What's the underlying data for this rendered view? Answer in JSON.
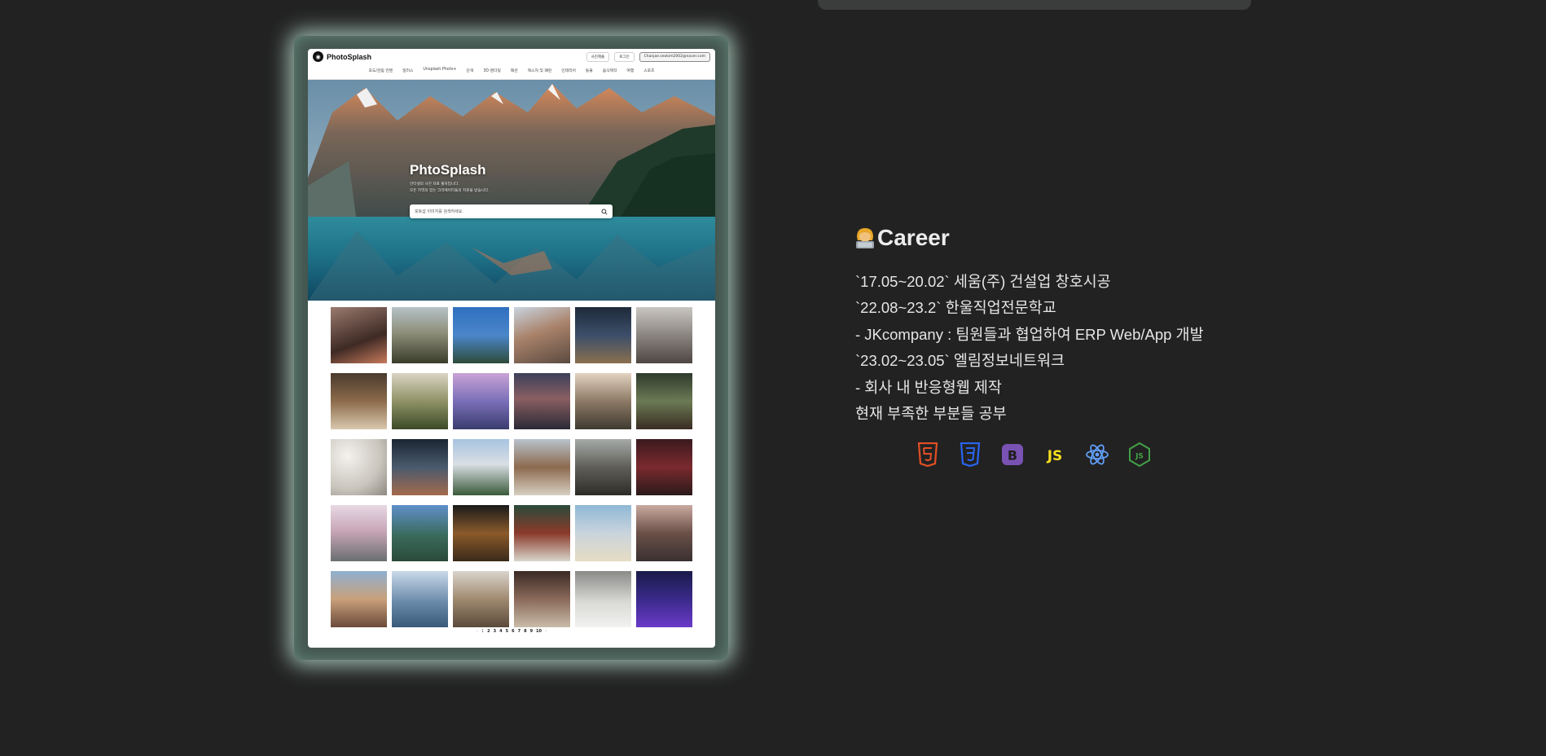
{
  "preview": {
    "logo": "PhotoSplash",
    "buttons": [
      "사진제출",
      "로그인",
      "Chanjae.seokim2002@naver.com"
    ],
    "nav": [
      "포도/관림 컨텐",
      "일러스",
      "Unsplash Photo+",
      "단색",
      "3D 렌더링",
      "패션",
      "텍스처 및 패턴",
      "인테리어",
      "동물",
      "음식제작",
      "여행",
      "스포츠"
    ],
    "hero": {
      "title": "PhtoSplash",
      "subtitle_lines": [
        "인터넷의 사진 자료 출처입니다.",
        "모든 지역의 있는 크리에이터들의 지원을 받습니다."
      ],
      "search_placeholder": "포토샵 이미지를 검색하세요."
    },
    "pagination": [
      "1",
      "2",
      "3",
      "4",
      "5",
      "6",
      "7",
      "8",
      "9",
      "10"
    ]
  },
  "career": {
    "icon": "person-at-laptop-icon",
    "title": "Career",
    "lines": [
      "`17.05~20.02` 세움(주) 건설업 창호시공",
      "`22.08~23.2` 한울직업전문학교",
      "- JKcompany : 팀원들과 협업하여 ERP Web/App 개발",
      "`23.02~23.05` 엘림정보네트워크",
      "- 회사 내 반응형웹 제작",
      "현재 부족한 부분들 공부"
    ],
    "tech_stack": [
      {
        "name": "html5-icon",
        "color": "#E34F26"
      },
      {
        "name": "css3-icon",
        "color": "#1572B6"
      },
      {
        "name": "bootstrap-icon",
        "color": "#7952B3"
      },
      {
        "name": "javascript-icon",
        "color": "#F7DF1E"
      },
      {
        "name": "react-icon",
        "color": "#61DAFB"
      },
      {
        "name": "nodejs-icon",
        "color": "#339933"
      }
    ]
  }
}
